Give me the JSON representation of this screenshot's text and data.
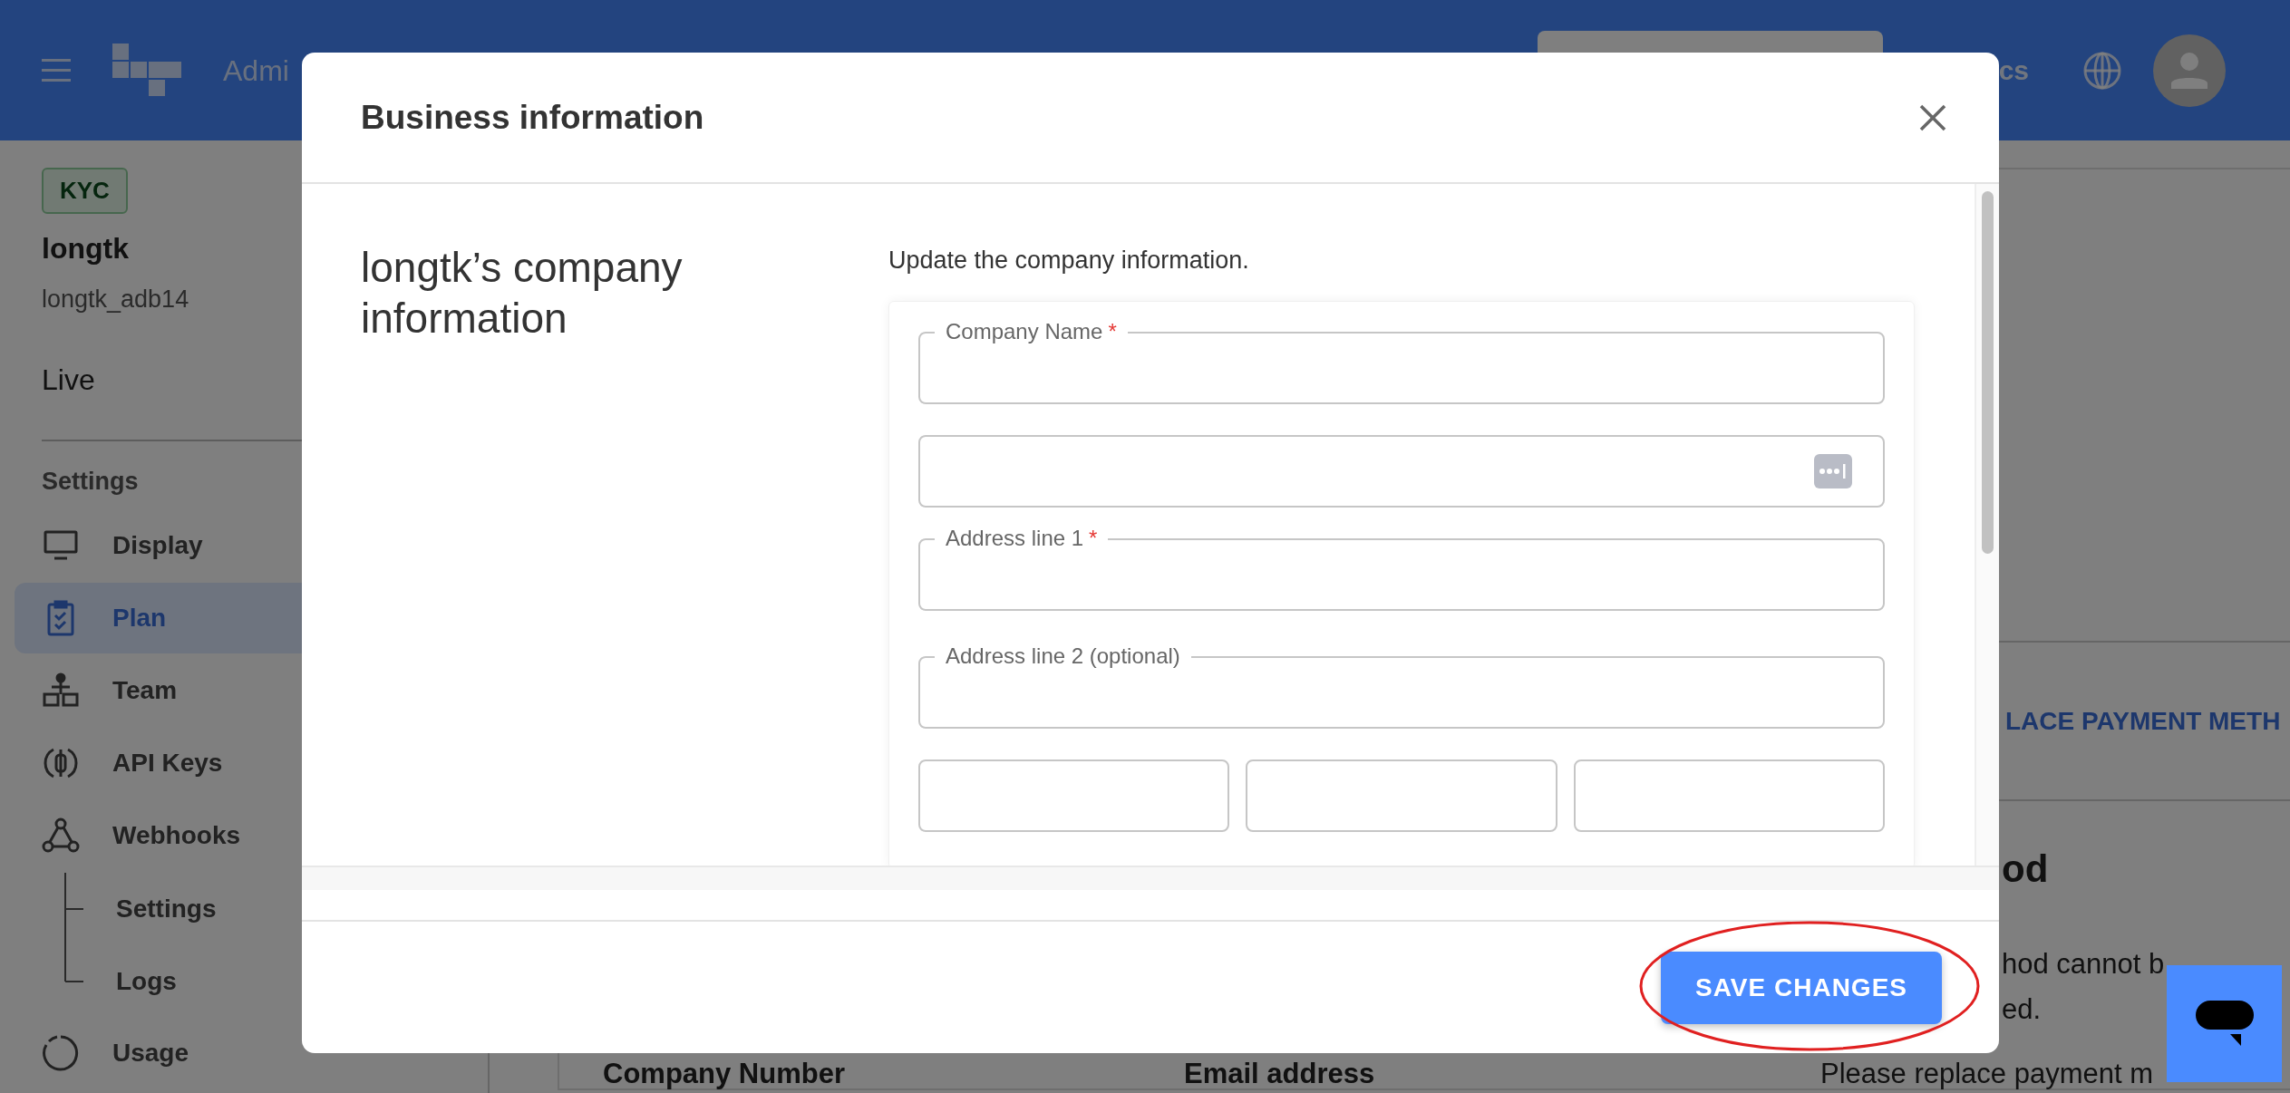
{
  "header": {
    "brand": "Admi",
    "nav_link": "cs"
  },
  "sidebar": {
    "badge": "KYC",
    "account_name": "longtk",
    "account_id": "longtk_adb14",
    "environment": "Live",
    "section_title": "Settings",
    "items": [
      {
        "label": "Display",
        "selected": false
      },
      {
        "label": "Plan",
        "selected": true
      },
      {
        "label": "Team",
        "selected": false
      },
      {
        "label": "API Keys",
        "selected": false
      },
      {
        "label": "Webhooks",
        "selected": false,
        "children": [
          {
            "label": "Settings",
            "selected": false
          },
          {
            "label": "Logs",
            "selected": false
          }
        ]
      },
      {
        "label": "Usage",
        "selected": false
      }
    ]
  },
  "page": {
    "link_button": "LACE PAYMENT METH",
    "heading": "od",
    "text_lines": [
      "hod cannot b",
      "ed."
    ],
    "field_labels": [
      "Company Number",
      "Email address"
    ],
    "note": "Please replace payment m"
  },
  "modal": {
    "title": "Business information",
    "heading": "longtk’s company information",
    "description": "Update the company information.",
    "fields": [
      {
        "kind": "text",
        "label": "Company Name",
        "required_mark": "*"
      },
      {
        "kind": "text",
        "autofill_icon": true
      },
      {
        "kind": "text",
        "label": "Address line 1",
        "required_mark": "*"
      },
      {
        "kind": "text",
        "label": "Address line 2 (optional)"
      },
      {
        "kind": "row",
        "fields": [
          {
            "kind": "text"
          },
          {
            "kind": "text"
          },
          {
            "kind": "text"
          }
        ]
      }
    ],
    "save_button": {
      "label": "SAVE CHANGES",
      "circled": true
    }
  }
}
